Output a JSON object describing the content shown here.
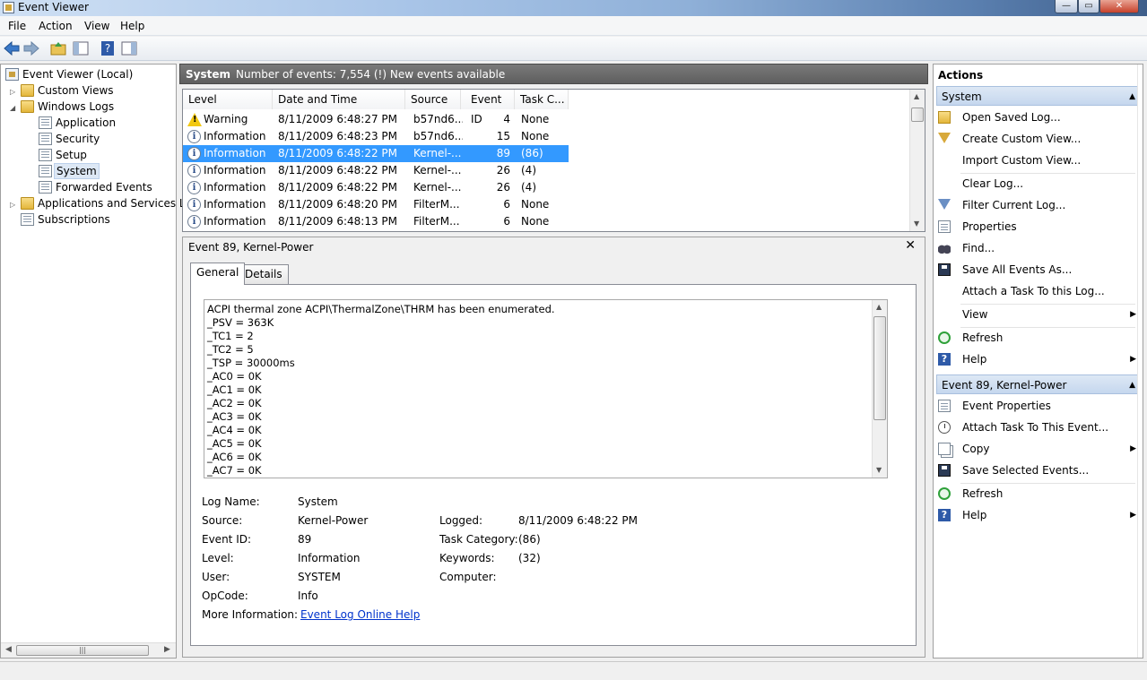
{
  "window": {
    "title": "Event Viewer"
  },
  "menu": {
    "file": "File",
    "action": "Action",
    "view": "View",
    "help": "Help"
  },
  "tree": {
    "root": "Event Viewer (Local)",
    "custom_views": "Custom Views",
    "windows_logs": "Windows Logs",
    "application": "Application",
    "security": "Security",
    "setup": "Setup",
    "system": "System",
    "forwarded": "Forwarded Events",
    "apps_services": "Applications and Services Lo",
    "subscriptions": "Subscriptions"
  },
  "center": {
    "log_name": "System",
    "summary": "Number of events: 7,554 (!) New events available"
  },
  "columns": {
    "level": "Level",
    "datetime": "Date and Time",
    "source": "Source",
    "event_id": "Event ID",
    "task": "Task C..."
  },
  "events": [
    {
      "icon": "warning-icon",
      "level": "Warning",
      "datetime": "8/11/2009 6:48:27 PM",
      "source": "b57nd6...",
      "event_id": "4",
      "task": "None"
    },
    {
      "icon": "information-icon",
      "level": "Information",
      "datetime": "8/11/2009 6:48:23 PM",
      "source": "b57nd6...",
      "event_id": "15",
      "task": "None"
    },
    {
      "icon": "information-icon",
      "level": "Information",
      "datetime": "8/11/2009 6:48:22 PM",
      "source": "Kernel-...",
      "event_id": "89",
      "task": "(86)"
    },
    {
      "icon": "information-icon",
      "level": "Information",
      "datetime": "8/11/2009 6:48:22 PM",
      "source": "Kernel-...",
      "event_id": "26",
      "task": "(4)"
    },
    {
      "icon": "information-icon",
      "level": "Information",
      "datetime": "8/11/2009 6:48:22 PM",
      "source": "Kernel-...",
      "event_id": "26",
      "task": "(4)"
    },
    {
      "icon": "information-icon",
      "level": "Information",
      "datetime": "8/11/2009 6:48:20 PM",
      "source": "FilterM...",
      "event_id": "6",
      "task": "None"
    },
    {
      "icon": "information-icon",
      "level": "Information",
      "datetime": "8/11/2009 6:48:13 PM",
      "source": "FilterM...",
      "event_id": "6",
      "task": "None"
    }
  ],
  "detail": {
    "header": "Event 89, Kernel-Power",
    "close_glyph": "✕",
    "tab_general": "General",
    "tab_details": "Details",
    "description": [
      "ACPI thermal zone ACPI\\ThermalZone\\THRM has been enumerated.",
      "_PSV = 363K",
      "_TC1 = 2",
      "_TC2 = 5",
      "_TSP = 30000ms",
      "_AC0 = 0K",
      "_AC1 = 0K",
      "_AC2 = 0K",
      "_AC3 = 0K",
      "_AC4 = 0K",
      "_AC5 = 0K",
      "_AC6 = 0K",
      "_AC7 = 0K"
    ],
    "fields": {
      "log_name_label": "Log Name:",
      "log_name": "System",
      "source_label": "Source:",
      "source": "Kernel-Power",
      "logged_label": "Logged:",
      "logged": "8/11/2009 6:48:22 PM",
      "event_id_label": "Event ID:",
      "event_id": "89",
      "task_category_label": "Task Category:",
      "task_category": "(86)",
      "level_label": "Level:",
      "level": "Information",
      "keywords_label": "Keywords:",
      "keywords": "(32)",
      "user_label": "User:",
      "user": "SYSTEM",
      "computer_label": "Computer:",
      "computer": "",
      "opcode_label": "OpCode:",
      "opcode": "Info",
      "more_info_label": "More Information:",
      "more_info_link": "Event Log Online Help"
    }
  },
  "actions": {
    "title": "Actions",
    "section_system": "System",
    "system_items": [
      {
        "label": "Open Saved Log...",
        "icon": "open-folder-icon"
      },
      {
        "label": "Create Custom View...",
        "icon": "filter-icon"
      },
      {
        "label": "Import Custom View...",
        "icon": ""
      },
      {
        "label": "Clear Log...",
        "icon": ""
      },
      {
        "label": "Filter Current Log...",
        "icon": "filter-icon"
      },
      {
        "label": "Properties",
        "icon": "properties-icon"
      },
      {
        "label": "Find...",
        "icon": "binoculars-icon"
      },
      {
        "label": "Save All Events As...",
        "icon": "save-icon"
      },
      {
        "label": "Attach a Task To this Log...",
        "icon": ""
      },
      {
        "label": "View",
        "icon": ""
      },
      {
        "label": "Refresh",
        "icon": "refresh-icon"
      },
      {
        "label": "Help",
        "icon": "help-icon"
      }
    ],
    "section_event": "Event 89, Kernel-Power",
    "event_items": [
      {
        "label": "Event Properties",
        "icon": "properties-icon"
      },
      {
        "label": "Attach Task To This Event...",
        "icon": "task-icon"
      },
      {
        "label": "Copy",
        "icon": "copy-icon"
      },
      {
        "label": "Save Selected Events...",
        "icon": "save-icon"
      },
      {
        "label": "Refresh",
        "icon": "refresh-icon"
      },
      {
        "label": "Help",
        "icon": "help-icon"
      }
    ]
  }
}
